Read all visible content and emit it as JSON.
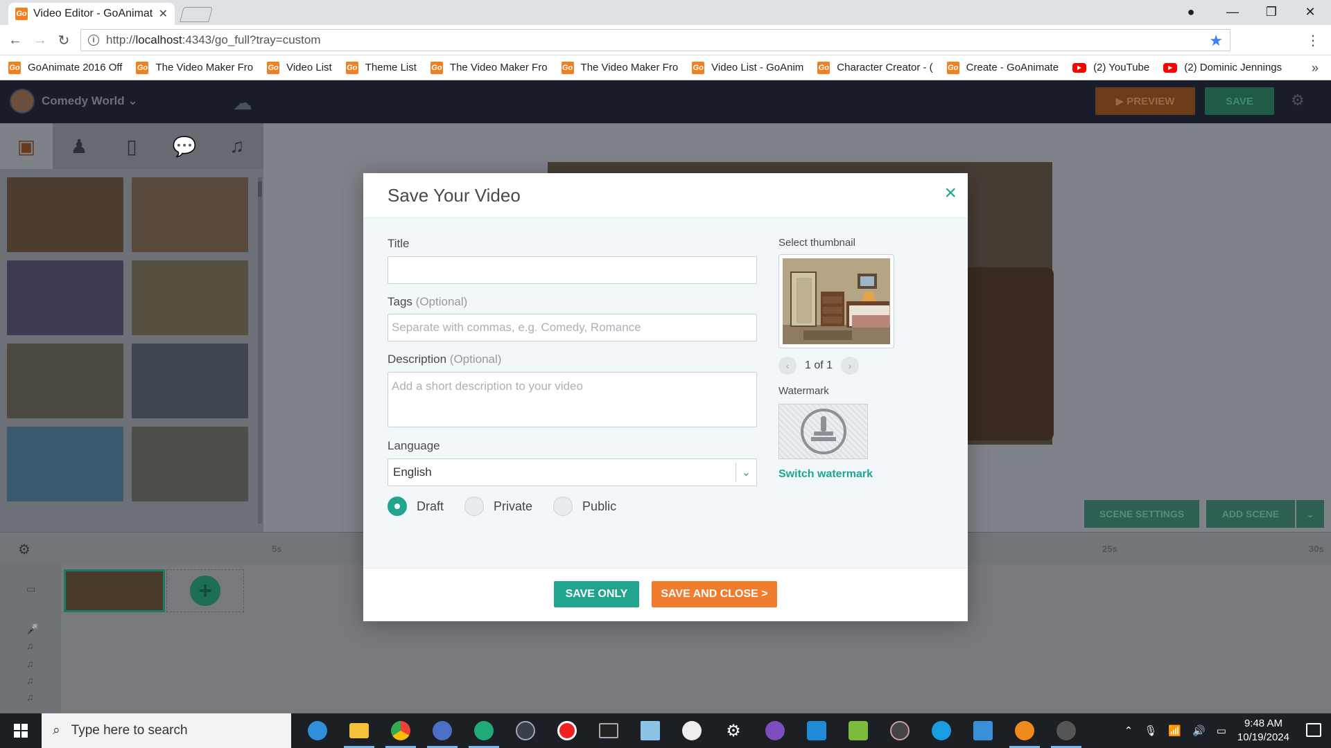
{
  "browser": {
    "tab_title": "Video Editor - GoAnimate",
    "url_prefix": "http://",
    "url_host": "localhost",
    "url_rest": ":4343/go_full?tray=custom",
    "bookmarks": [
      {
        "label": "GoAnimate 2016 Off",
        "icon": "go"
      },
      {
        "label": "The Video Maker Fro",
        "icon": "go"
      },
      {
        "label": "Video List",
        "icon": "go"
      },
      {
        "label": "Theme List",
        "icon": "go"
      },
      {
        "label": "The Video Maker Fro",
        "icon": "go"
      },
      {
        "label": "The Video Maker Fro",
        "icon": "go"
      },
      {
        "label": "Video List - GoAnim",
        "icon": "go"
      },
      {
        "label": "Character Creator - (",
        "icon": "go"
      },
      {
        "label": "Create - GoAnimate",
        "icon": "go"
      },
      {
        "label": "(2) YouTube",
        "icon": "yt"
      },
      {
        "label": "(2) Dominic Jennings",
        "icon": "yt"
      }
    ]
  },
  "app": {
    "project_name": "Comedy World",
    "preview_label": "PREVIEW",
    "save_label": "SAVE",
    "scene_settings_label": "SCENE SETTINGS",
    "add_scene_label": "ADD SCENE",
    "timeline_ticks": [
      "5s",
      "25s",
      "30s"
    ]
  },
  "modal": {
    "title": "Save Your Video",
    "title_label": "Title",
    "title_value": "",
    "tags_label": "Tags",
    "tags_optional": "(Optional)",
    "tags_placeholder": "Separate with commas, e.g. Comedy, Romance",
    "description_label": "Description",
    "description_optional": "(Optional)",
    "description_placeholder": "Add a short description to your video",
    "language_label": "Language",
    "language_value": "English",
    "privacy_options": [
      {
        "label": "Draft",
        "selected": true
      },
      {
        "label": "Private",
        "selected": false
      },
      {
        "label": "Public",
        "selected": false
      }
    ],
    "thumbnail_label": "Select thumbnail",
    "thumbnail_pager": "1 of 1",
    "watermark_label": "Watermark",
    "switch_watermark": "Switch watermark",
    "save_only": "SAVE ONLY",
    "save_and_close": "SAVE AND CLOSE >",
    "accent_color": "#21a58e",
    "orange_color": "#f07d2d"
  },
  "taskbar": {
    "search_placeholder": "Type here to search",
    "time": "9:48 AM",
    "date": "10/19/2024"
  }
}
